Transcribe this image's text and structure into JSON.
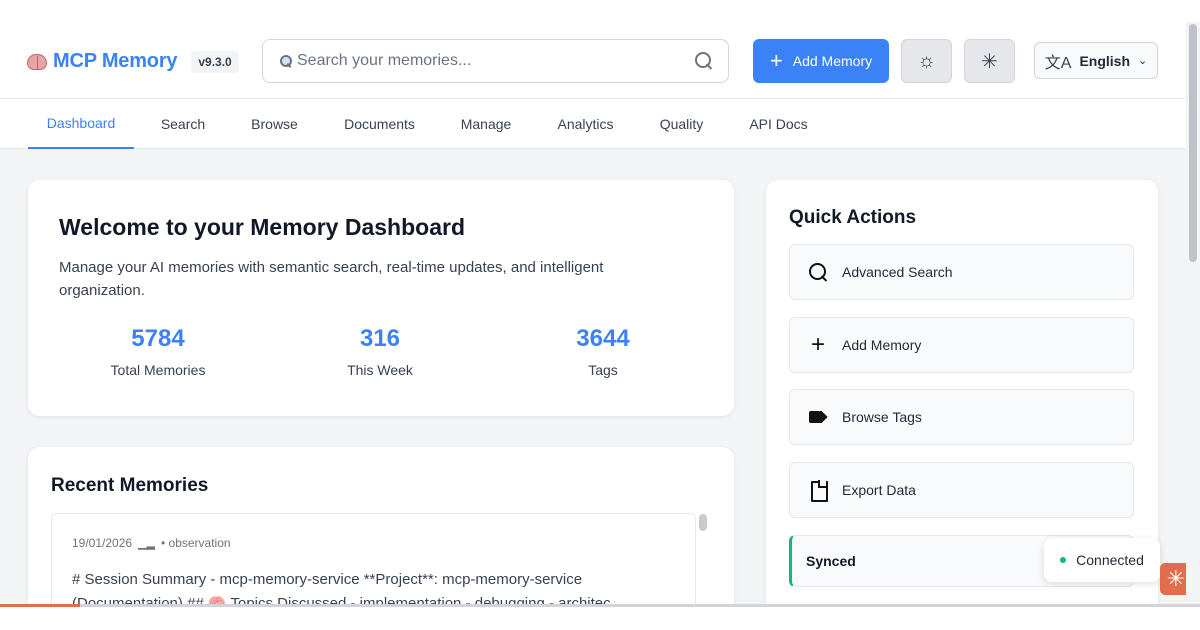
{
  "app": {
    "name": "MCP Memory",
    "version": "v9.3.0"
  },
  "search": {
    "placeholder": "Search your memories..."
  },
  "header": {
    "add_memory_label": "Add Memory",
    "language_label": "English"
  },
  "nav": {
    "tabs": [
      "Dashboard",
      "Search",
      "Browse",
      "Documents",
      "Manage",
      "Analytics",
      "Quality",
      "API Docs"
    ],
    "active": "Dashboard"
  },
  "welcome": {
    "title": "Welcome to your Memory Dashboard",
    "description": "Manage your AI memories with semantic search, real-time updates, and intelligent organization.",
    "stats": [
      {
        "value": "5784",
        "label": "Total Memories"
      },
      {
        "value": "316",
        "label": "This Week"
      },
      {
        "value": "3644",
        "label": "Tags"
      }
    ]
  },
  "recent": {
    "title": "Recent Memories",
    "items": [
      {
        "date": "19/01/2026",
        "type": "• observation",
        "text": "# Session Summary - mcp-memory-service **Project**: mcp-memory-service (Documentation) ## 🧠 Topics Discussed - implementation - debugging - architec..."
      }
    ]
  },
  "quick_actions": {
    "title": "Quick Actions",
    "items": [
      "Advanced Search",
      "Add Memory",
      "Browse Tags",
      "Export Data"
    ],
    "sync_status": "Synced"
  },
  "connection": {
    "status": "Connected"
  },
  "colors": {
    "accent": "#3b82f6",
    "success": "#10b981",
    "corner_badge": "#e26d4d"
  }
}
